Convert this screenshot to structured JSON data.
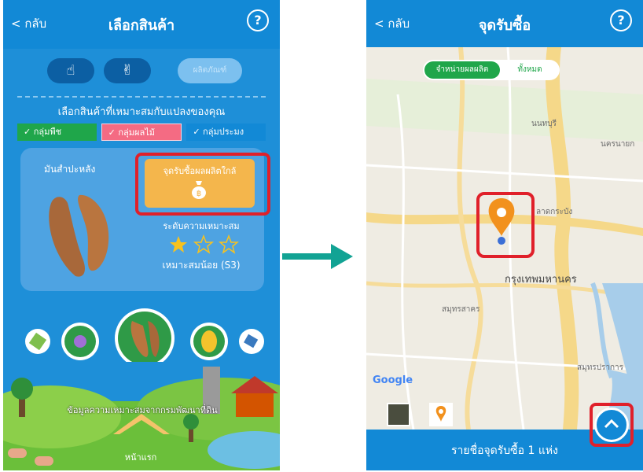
{
  "left_screen": {
    "back_label": "< กลับ",
    "title": "เลือกสินค้า",
    "help_label": "?",
    "step_third_label": "ผลิตภัณฑ์",
    "instruction": "เลือกสินค้าที่เหมาะสมกับแปลงของคุณ",
    "groups": [
      {
        "label": "✓ กลุ่มพืช"
      },
      {
        "label": "✓ กลุ่มผลไม้"
      },
      {
        "label": "✓ กลุ่มประมง"
      }
    ],
    "product_name": "มันสำปะหลัง",
    "pickup_button_label": "จุดรับซื้อผลผลิตใกล้",
    "suitability_label": "ระดับความเหมาะสม",
    "suitability_value": "เหมาะสมน้อย (S3)",
    "suitability_stars": 1,
    "suitability_stars_max": 3,
    "scene_text": "ข้อมูลความเหมาะสมจากกรมพัฒนาที่ดิน",
    "home_label": "หน้าแรก"
  },
  "right_screen": {
    "back_label": "< กลับ",
    "title": "จุดรับซื้อ",
    "help_label": "?",
    "filter_selected": "จำหน่ายผลผลิต",
    "filter_all": "ทั้งหมด",
    "map_labels": {
      "north": "นนทบุรี",
      "east": "นครนายก",
      "center": "กรุงเทพมหานคร",
      "west": "สมุทรสาคร",
      "mid": "ลาดกระบัง",
      "south": "สมุทรปราการ"
    },
    "google": "Google",
    "bottom_text": "รายชื่อจุดรับซื้อ 1 แห่ง"
  },
  "colors": {
    "primary_blue": "#1289d6",
    "accent_orange": "#f4b64c",
    "highlight_red": "#e0202a",
    "green": "#1fa64a",
    "arrow_teal": "#12a394"
  }
}
